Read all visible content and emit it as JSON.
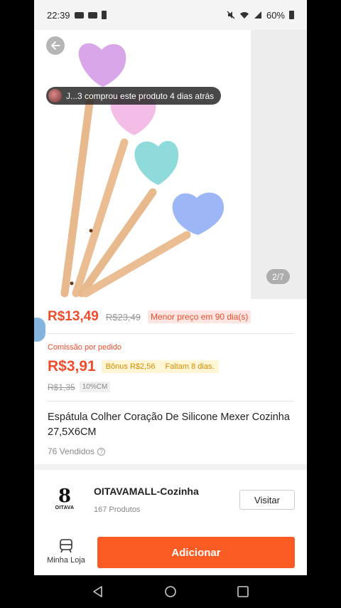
{
  "status_bar": {
    "time": "22:39",
    "battery": "60%"
  },
  "gallery": {
    "back_icon": "arrow-left-icon",
    "buyer_notice": "J...3 comprou este produto 4 dias atrás",
    "page_indicator": "2/7"
  },
  "price": {
    "current": "R$13,49",
    "original": "R$23,49",
    "badge": "Menor preço em 90 dia(s)"
  },
  "commission": {
    "label": "Comissão por pedido",
    "value": "R$3,91",
    "bonus": "Bônus R$2,56",
    "remaining": "Faltam 8 dias.",
    "old_value": "R$1,35",
    "rate": "10%CM"
  },
  "product": {
    "title": "Espátula Colher Coração De Silicone Mexer Cozinha 27,5X6CM",
    "sold": "76 Vendidos"
  },
  "shop": {
    "logo_mark": "8",
    "logo_text": "OITAVA",
    "name": "OITAVAMALL-Cozinha",
    "products": "167 Produtos",
    "visit_label": "Visitar"
  },
  "bottom_bar": {
    "store_label": "Minha Loja",
    "add_label": "Adicionar"
  },
  "colors": {
    "accent": "#ee4d2d",
    "add_button": "#fa5b23",
    "bonus_text": "#d98b00"
  }
}
